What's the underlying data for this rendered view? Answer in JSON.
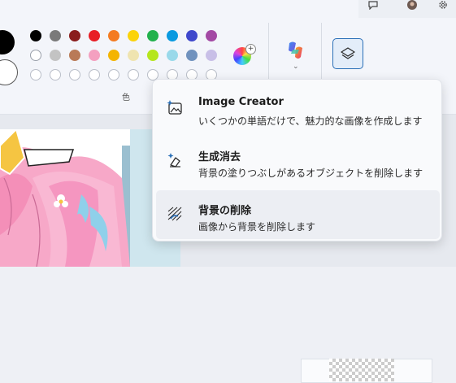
{
  "colors": {
    "accent": "#2a6fb7",
    "palette_row1": [
      "#000000",
      "#7a7a7a",
      "#8a1d1d",
      "#e81e25",
      "#f47b20",
      "#fbd30a",
      "#22b14c",
      "#0a9ae0",
      "#3f48cc",
      "#a349a4"
    ],
    "palette_row2": [
      "#ffffff",
      "#c3c3c3",
      "#b97a57",
      "#f4a0c0",
      "#f4b400",
      "#efe4b0",
      "#b5e61d",
      "#99d9ea",
      "#7092be",
      "#c8bfe7"
    ]
  },
  "ribbon": {
    "colors_group_label": "色",
    "color_picker_icon": "rainbow-plus-icon",
    "copilot_icon": "copilot-icon",
    "layers_icon": "layers-icon"
  },
  "menu": {
    "items": [
      {
        "icon": "image-creator-icon",
        "title": "Image Creator",
        "desc": "いくつかの単語だけで、魅力的な画像を作成します",
        "selected": false
      },
      {
        "icon": "generative-erase-icon",
        "title": "生成消去",
        "desc": "背景の塗りつぶしがあるオブジェクトを削除します",
        "selected": false
      },
      {
        "icon": "remove-background-icon",
        "title": "背景の削除",
        "desc": "画像から背景を削除します",
        "selected": true
      }
    ]
  }
}
